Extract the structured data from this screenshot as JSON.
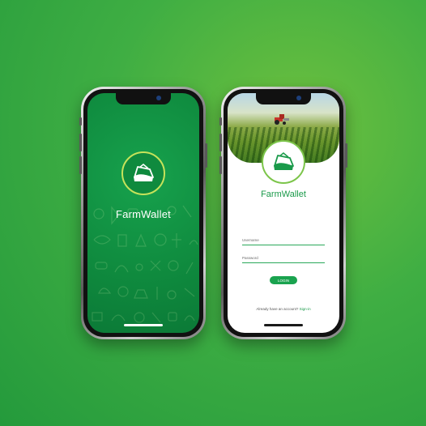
{
  "brand": {
    "name": "FarmWallet"
  },
  "login": {
    "username_placeholder": "Username",
    "password_placeholder": "Password",
    "login_button": "LOGIN",
    "no_account_text": "Already have an account?",
    "sign_in_link": "Sign-in"
  },
  "colors": {
    "background_green": "#3fae43",
    "splash_green": "#0f8a3e",
    "accent_lime": "#b7dd4a",
    "brand_text_green": "#1a9a4a",
    "button_green": "#1aa34f"
  },
  "icons": [
    "farm-wallet-logo-icon",
    "tractor-icon",
    "farm-doodle-pattern"
  ]
}
